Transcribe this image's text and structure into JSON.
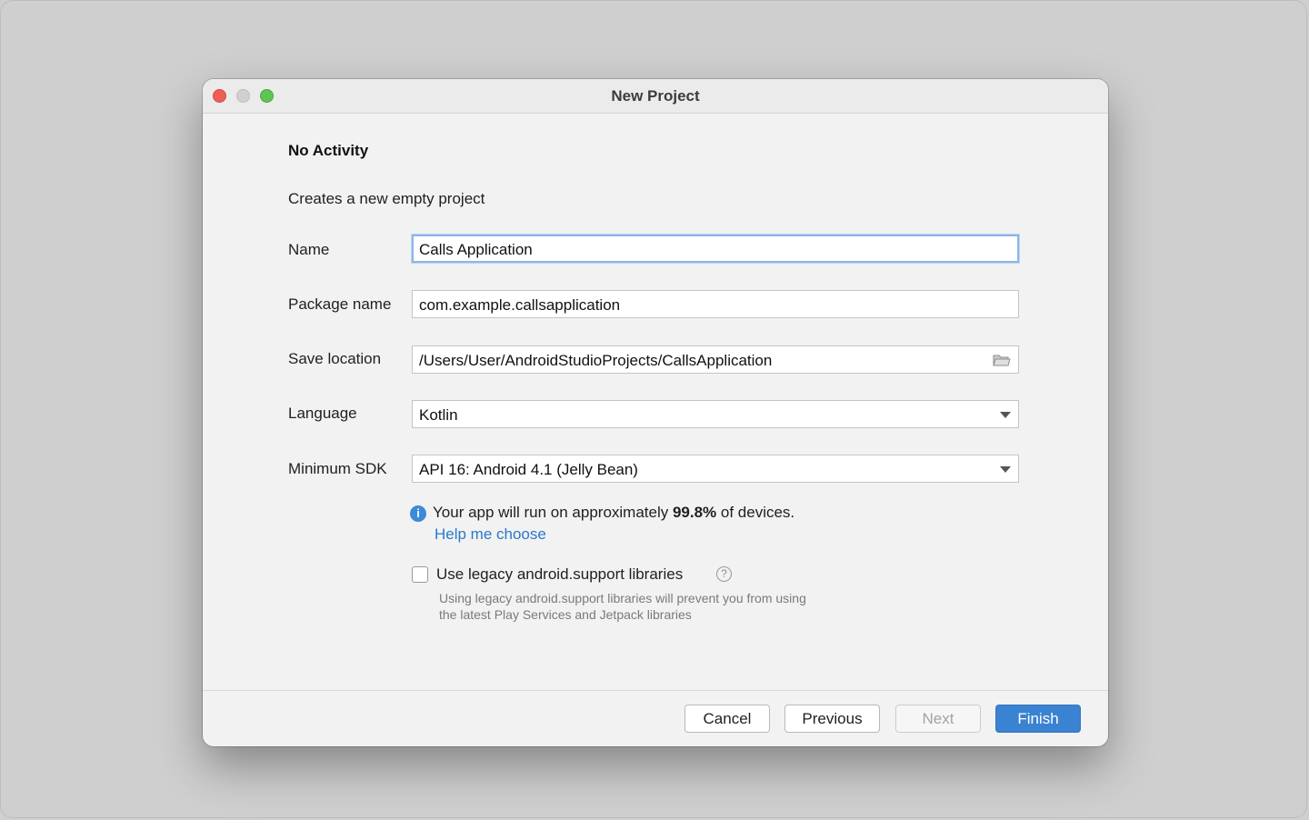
{
  "window": {
    "title": "New Project"
  },
  "template": {
    "heading": "No Activity",
    "description": "Creates a new empty project"
  },
  "form": {
    "name": {
      "label": "Name",
      "value": "Calls Application"
    },
    "package": {
      "label": "Package name",
      "value": "com.example.callsapplication"
    },
    "location": {
      "label": "Save location",
      "value": "/Users/User/AndroidStudioProjects/CallsApplication",
      "icon": "folder-icon"
    },
    "language": {
      "label": "Language",
      "value": "Kotlin"
    },
    "min_sdk": {
      "label": "Minimum SDK",
      "value": "API 16: Android 4.1 (Jelly Bean)"
    }
  },
  "info": {
    "icon": "info-icon",
    "prefix": "Your app will run on approximately ",
    "percent": "99.8%",
    "suffix": " of devices.",
    "help_link": "Help me choose"
  },
  "legacy": {
    "checked": false,
    "label": "Use legacy android.support libraries",
    "hint_line1": "Using legacy android.support libraries will prevent you from using",
    "hint_line2": "the latest Play Services and Jetpack libraries"
  },
  "buttons": {
    "cancel": "Cancel",
    "previous": "Previous",
    "next": "Next",
    "finish": "Finish"
  },
  "colors": {
    "accent": "#3a82d2",
    "link": "#2a79c8",
    "close": "#ee5e57",
    "zoom": "#5fc454"
  }
}
